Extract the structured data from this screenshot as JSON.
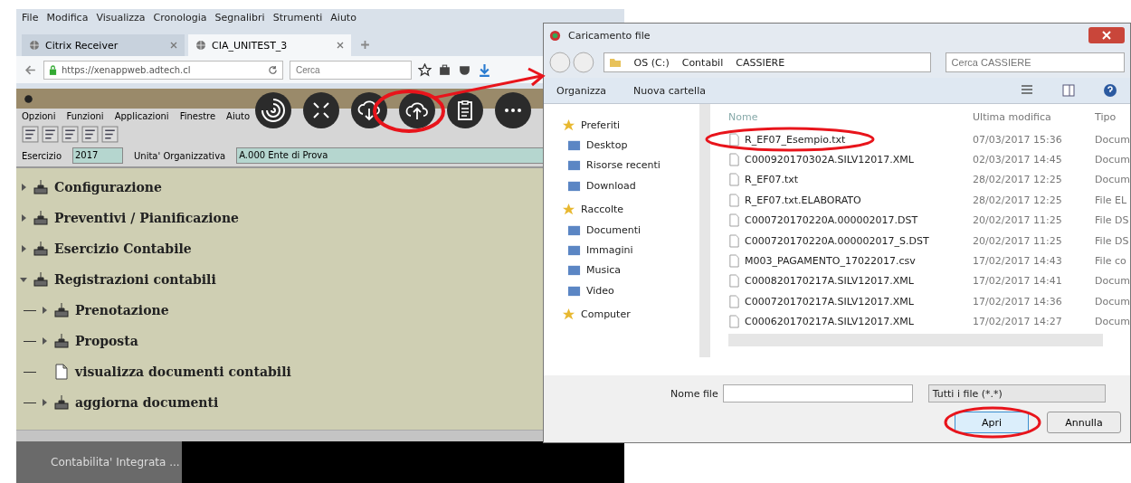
{
  "browser": {
    "menu": [
      "File",
      "Modifica",
      "Visualizza",
      "Cronologia",
      "Segnalibri",
      "Strumenti",
      "Aiuto"
    ],
    "tabs": [
      {
        "label": "Citrix Receiver",
        "selected": false
      },
      {
        "label": "CIA_UNITEST_3",
        "selected": true
      }
    ],
    "url": "https://xenappweb.adtech.cl",
    "search": {
      "placeholder": "Cerca"
    }
  },
  "app": {
    "menu": [
      "Opzioni",
      "Funzioni",
      "Applicazioni",
      "Finestre",
      "Aiuto"
    ],
    "fields": [
      {
        "label": "Esercizio",
        "value": "2017"
      },
      {
        "label": "Unita' Organizzativa",
        "value": "A.000 Ente di Prova"
      }
    ],
    "tree": [
      {
        "label": "Configurazione",
        "kind": "branch",
        "expanded": false
      },
      {
        "label": "Preventivi / Pianificazione",
        "kind": "branch",
        "expanded": false
      },
      {
        "label": "Esercizio Contabile",
        "kind": "branch",
        "expanded": false
      },
      {
        "label": "Registrazioni contabili",
        "kind": "branch",
        "expanded": true,
        "children": [
          {
            "label": "Prenotazione",
            "kind": "branch",
            "expanded": false
          },
          {
            "label": "Proposta",
            "kind": "branch",
            "expanded": false
          },
          {
            "label": "visualizza documenti contabili",
            "kind": "leaf"
          },
          {
            "label": "aggiorna documenti",
            "kind": "branch",
            "expanded": false
          }
        ]
      }
    ]
  },
  "taskbar": {
    "items": [
      {
        "label": "Contabilita' Integrata ..."
      }
    ]
  },
  "dialog": {
    "title": "Caricamento file",
    "breadcrumb": [
      "OS (C:)",
      "Contabil",
      "CASSIERE"
    ],
    "search": {
      "placeholder": "Cerca CASSIERE"
    },
    "toolbar": [
      "Organizza",
      "Nuova cartella"
    ],
    "nav": [
      {
        "label": "Preferiti",
        "kind": "group"
      },
      {
        "label": "Desktop",
        "kind": "item"
      },
      {
        "label": "Risorse recenti",
        "kind": "item"
      },
      {
        "label": "Download",
        "kind": "item"
      },
      {
        "label": "Raccolte",
        "kind": "group"
      },
      {
        "label": "Documenti",
        "kind": "item"
      },
      {
        "label": "Immagini",
        "kind": "item"
      },
      {
        "label": "Musica",
        "kind": "item"
      },
      {
        "label": "Video",
        "kind": "item"
      },
      {
        "label": "Computer",
        "kind": "group"
      }
    ],
    "columns": [
      "Nome",
      "Ultima modifica",
      "Tipo"
    ],
    "files": [
      {
        "name": "R_EF07_Esempio.txt",
        "modified": "07/03/2017 15:36",
        "type": "Docum"
      },
      {
        "name": "C000920170302A.SILV12017.XML",
        "modified": "02/03/2017 14:45",
        "type": "Docum"
      },
      {
        "name": "R_EF07.txt",
        "modified": "28/02/2017 12:25",
        "type": "Docum"
      },
      {
        "name": "R_EF07.txt.ELABORATO",
        "modified": "28/02/2017 12:25",
        "type": "File EL"
      },
      {
        "name": "C000720170220A.000002017.DST",
        "modified": "20/02/2017 11:25",
        "type": "File DS"
      },
      {
        "name": "C000720170220A.000002017_S.DST",
        "modified": "20/02/2017 11:25",
        "type": "File DS"
      },
      {
        "name": "M003_PAGAMENTO_17022017.csv",
        "modified": "17/02/2017 14:43",
        "type": "File co"
      },
      {
        "name": "C000820170217A.SILV12017.XML",
        "modified": "17/02/2017 14:41",
        "type": "Docum"
      },
      {
        "name": "C000720170217A.SILV12017.XML",
        "modified": "17/02/2017 14:36",
        "type": "Docum"
      },
      {
        "name": "C000620170217A.SILV12017.XML",
        "modified": "17/02/2017 14:27",
        "type": "Docum"
      }
    ],
    "filename": {
      "label": "Nome file"
    },
    "filter": "Tutti i file (*.*)",
    "buttons": [
      "Apri",
      "Annulla"
    ]
  }
}
